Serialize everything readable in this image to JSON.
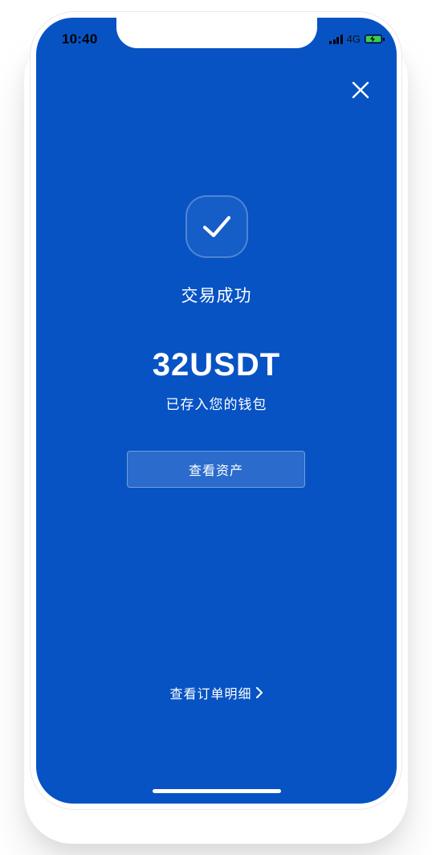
{
  "status_bar": {
    "time": "10:40",
    "network": "4G"
  },
  "result": {
    "title": "交易成功",
    "amount": "32USDT",
    "subtitle": "已存入您的钱包"
  },
  "actions": {
    "view_assets_label": "查看资产",
    "view_order_label": "查看订单明细"
  },
  "icons": {
    "close": "close-icon",
    "success": "checkmark-icon",
    "chevron": "chevron-right-icon",
    "signal": "cellular-signal-icon",
    "battery": "battery-charging-icon"
  },
  "colors": {
    "background": "#0753c4",
    "text": "#ffffff",
    "battery_fill": "#3ccf3f"
  }
}
